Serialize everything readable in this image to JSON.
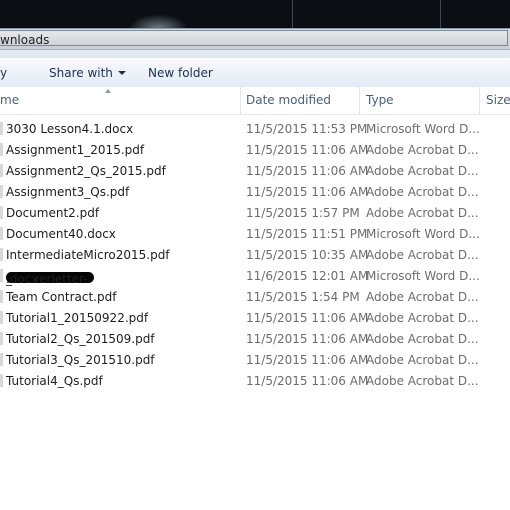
{
  "window": {
    "address_text": "wnloads"
  },
  "toolbar": {
    "organize_label": "y",
    "share_label": "Share with",
    "new_folder_label": "New folder"
  },
  "columns": {
    "name": "me",
    "date": "Date modified",
    "type": "Type",
    "size": "Size"
  },
  "files": [
    {
      "name": "3030 Lesson4.1.docx",
      "date": "11/5/2015 11:53 PM",
      "type": "Microsoft Word D..."
    },
    {
      "name": "Assignment1_2015.pdf",
      "date": "11/5/2015 11:06 AM",
      "type": "Adobe Acrobat D..."
    },
    {
      "name": "Assignment2_Qs_2015.pdf",
      "date": "11/5/2015 11:06 AM",
      "type": "Adobe Acrobat D..."
    },
    {
      "name": "Assignment3_Qs.pdf",
      "date": "11/5/2015 11:06 AM",
      "type": "Adobe Acrobat D..."
    },
    {
      "name": "Document2.pdf",
      "date": "11/5/2015 1:57 PM",
      "type": "Adobe Acrobat D..."
    },
    {
      "name": "Document40.docx",
      "date": "11/5/2015 11:51 PM",
      "type": "Microsoft Word D..."
    },
    {
      "name": "IntermediateMicro2015.pdf",
      "date": "11/5/2015 10:35 AM",
      "type": "Adobe Acrobat D..."
    },
    {
      "name_mid": "_-Coverletter-",
      "name_end": ".docx",
      "date": "11/6/2015 12:01 AM",
      "type": "Microsoft Word D..."
    },
    {
      "name": "Team Contract.pdf",
      "date": "11/5/2015 1:54 PM",
      "type": "Adobe Acrobat D..."
    },
    {
      "name": "Tutorial1_20150922.pdf",
      "date": "11/5/2015 11:06 AM",
      "type": "Adobe Acrobat D..."
    },
    {
      "name": "Tutorial2_Qs_201509.pdf",
      "date": "11/5/2015 11:06 AM",
      "type": "Adobe Acrobat D..."
    },
    {
      "name": "Tutorial3_Qs_201510.pdf",
      "date": "11/5/2015 11:06 AM",
      "type": "Adobe Acrobat D..."
    },
    {
      "name": "Tutorial4_Qs.pdf",
      "date": "11/5/2015 11:06 AM",
      "type": "Adobe Acrobat D..."
    }
  ]
}
